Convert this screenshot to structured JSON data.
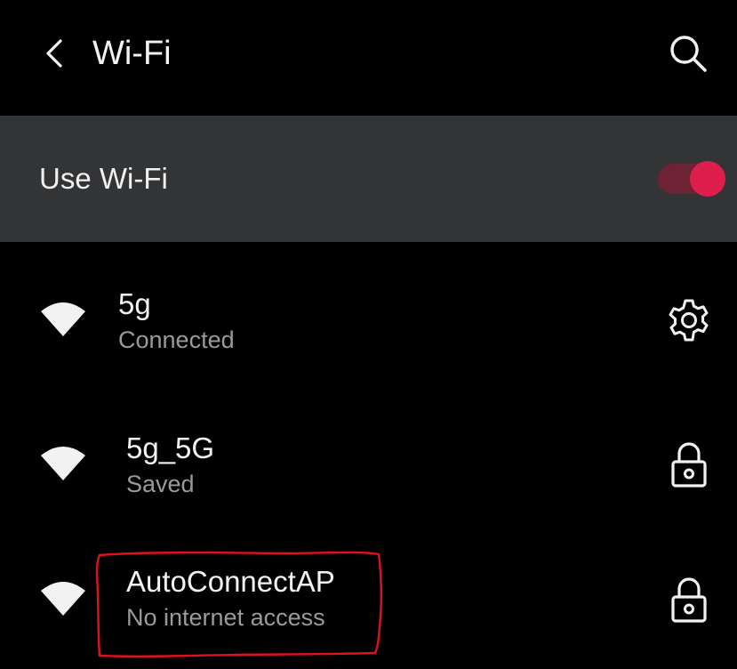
{
  "header": {
    "title": "Wi-Fi",
    "back_icon": "chevron-left-icon",
    "search_icon": "search-icon"
  },
  "master_switch": {
    "label": "Use Wi-Fi",
    "enabled": true,
    "thumb_color": "#de1f4d",
    "track_color": "#6e2335"
  },
  "networks": [
    {
      "name": "5g",
      "status": "Connected",
      "signal_icon": "wifi-signal-icon",
      "action_icon": "gear-icon"
    },
    {
      "name": "5g_5G",
      "status": "Saved",
      "signal_icon": "wifi-signal-icon",
      "action_icon": "lock-icon"
    },
    {
      "name": "AutoConnectAP",
      "status": "No internet access",
      "signal_icon": "wifi-signal-icon",
      "action_icon": "lock-icon"
    }
  ],
  "colors": {
    "background": "#000000",
    "master_row": "#333436",
    "primary_text": "#f2f2f2",
    "secondary_text": "#9a9a9a",
    "annotation": "#e0101e"
  }
}
